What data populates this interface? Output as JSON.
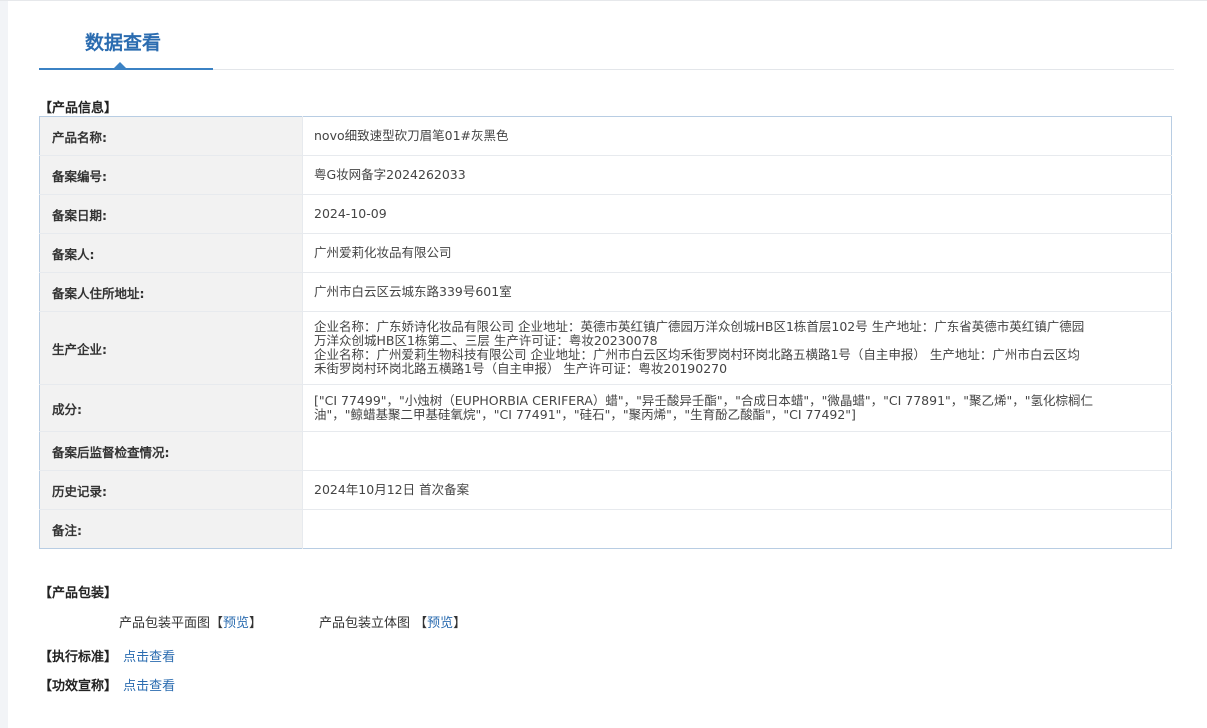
{
  "page": {
    "title": "数据查看"
  },
  "product_info": {
    "section_title": "【产品信息】",
    "rows": [
      {
        "label": "产品名称:",
        "value": "novo细致速型砍刀眉笔01#灰黑色"
      },
      {
        "label": "备案编号:",
        "value": "粤G妆网备字2024262033"
      },
      {
        "label": "备案日期:",
        "value": "2024-10-09"
      },
      {
        "label": "备案人:",
        "value": "广州爱莉化妆品有限公司"
      },
      {
        "label": "备案人住所地址:",
        "value": "广州市白云区云城东路339号601室"
      },
      {
        "label": "生产企业:",
        "value_lines": [
          "企业名称：广东娇诗化妆品有限公司 企业地址：英德市英红镇广德园万洋众创城HB区1栋首层102号 生产地址：广东省英德市英红镇广德园",
          "万洋众创城HB区1栋第二、三层 生产许可证：粤妆20230078",
          "企业名称：广州爱莉生物科技有限公司 企业地址：广州市白云区均禾街罗岗村环岗北路五横路1号（自主申报） 生产地址：广州市白云区均",
          "禾街罗岗村环岗北路五横路1号（自主申报） 生产许可证：粤妆20190270"
        ]
      },
      {
        "label": "成分:",
        "value_lines": [
          "[\"CI 77499\"，\"小烛树（EUPHORBIA CERIFERA）蜡\"，\"异壬酸异壬酯\"，\"合成日本蜡\"，\"微晶蜡\"，\"CI 77891\"，\"聚乙烯\"，\"氢化棕榈仁",
          "油\"，\"鲸蜡基聚二甲基硅氧烷\"，\"CI 77491\"，\"硅石\"，\"聚丙烯\"，\"生育酚乙酸酯\"，\"CI 77492\"]"
        ]
      },
      {
        "label": "备案后监督检查情况:",
        "value": ""
      },
      {
        "label": "历史记录:",
        "value": "2024年10月12日 首次备案"
      },
      {
        "label": "备注:",
        "value": ""
      }
    ]
  },
  "packaging": {
    "section_title": "【产品包装】",
    "flat_label": "产品包装平面图【",
    "flat_link": "预览",
    "flat_close": "】",
    "solid_label": "产品包装立体图 【",
    "solid_link": "预览",
    "solid_close": "】"
  },
  "standard": {
    "label": "【执行标准】",
    "link": "点击查看"
  },
  "efficacy": {
    "label": "【功效宣称】",
    "link": "点击查看"
  }
}
